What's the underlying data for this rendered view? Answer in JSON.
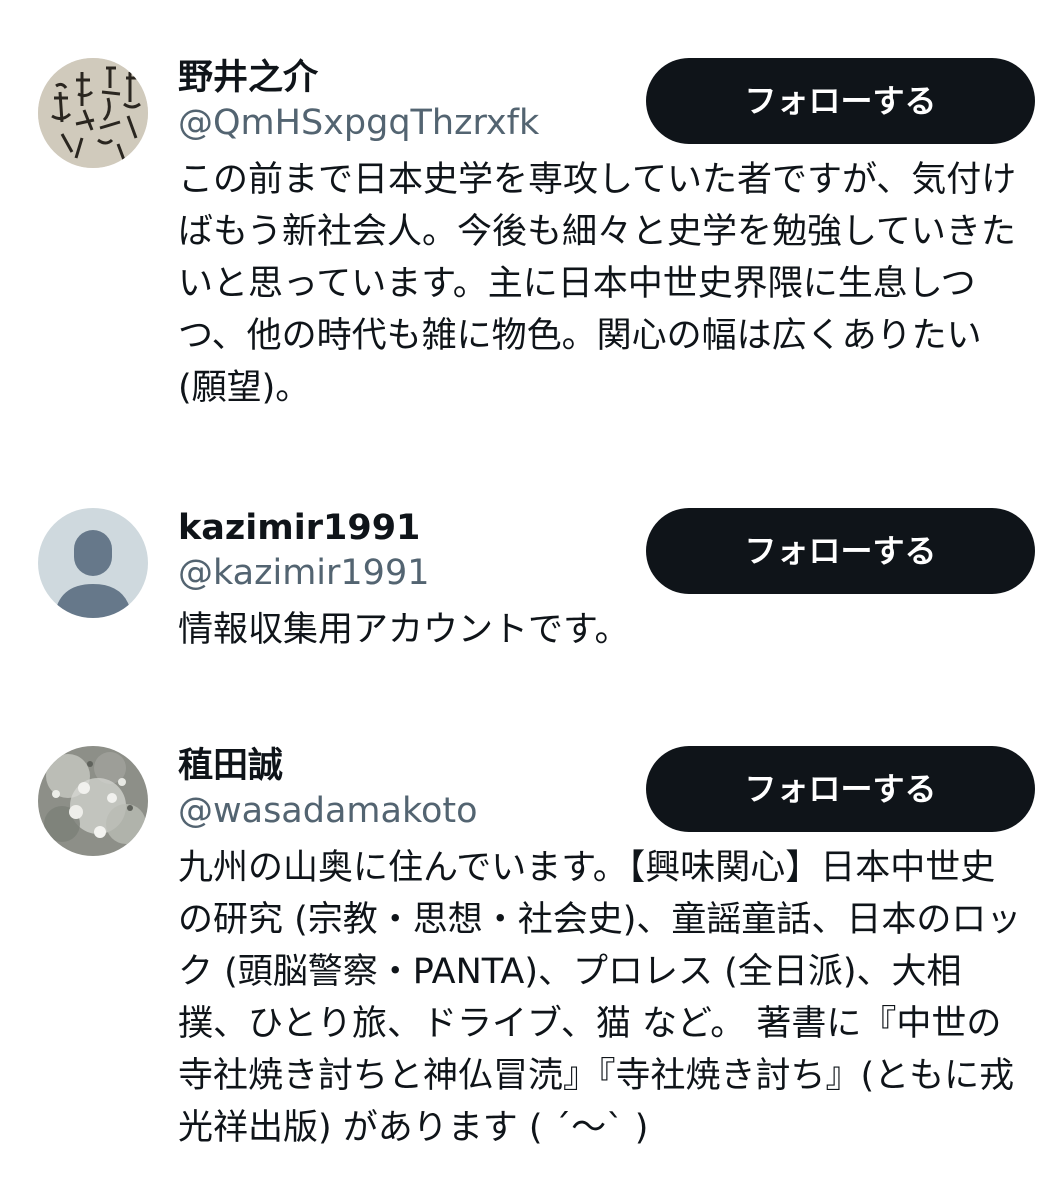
{
  "users": [
    {
      "name": "野井之介",
      "handle": "@QmHSxpgqThzrxfk",
      "bio": "この前まで日本史学を専攻していた者ですが、気付けばもう新社会人。今後も細々と史学を勉強していきたいと思っています。主に日本中世史界隈に生息しつつ、他の時代も雑に物色。関心の幅は広くありたい (願望)。",
      "follow_label": "フォローする",
      "avatar_icon": "calligraphy-avatar-icon"
    },
    {
      "name": "kazimir1991",
      "handle": "@kazimir1991",
      "bio": "情報収集用アカウントです。",
      "follow_label": "フォローする",
      "avatar_icon": "default-person-avatar-icon"
    },
    {
      "name": "稙田誠",
      "handle": "@wasadamakoto",
      "bio": "九州の山奥に住んでいます。【興味関心】日本中世史の研究 (宗教・思想・社会史)、童謡童話、日本のロック (頭脳警察・PANTA)、プロレス (全日派)、大相撲、ひとり旅、ドライブ、猫 など。 著書に『中世の寺社焼き討ちと神仏冒涜』『寺社焼き討ち』(ともに戎光祥出版) があります ( ´〜` )",
      "follow_label": "フォローする",
      "avatar_icon": "stone-texture-avatar-icon"
    }
  ],
  "colors": {
    "text_primary": "#0f1419",
    "text_secondary": "#536471",
    "button_bg": "#0f1419",
    "button_text": "#ffffff",
    "default_avatar_bg": "#cfd9de",
    "default_avatar_fg": "#66788a"
  }
}
